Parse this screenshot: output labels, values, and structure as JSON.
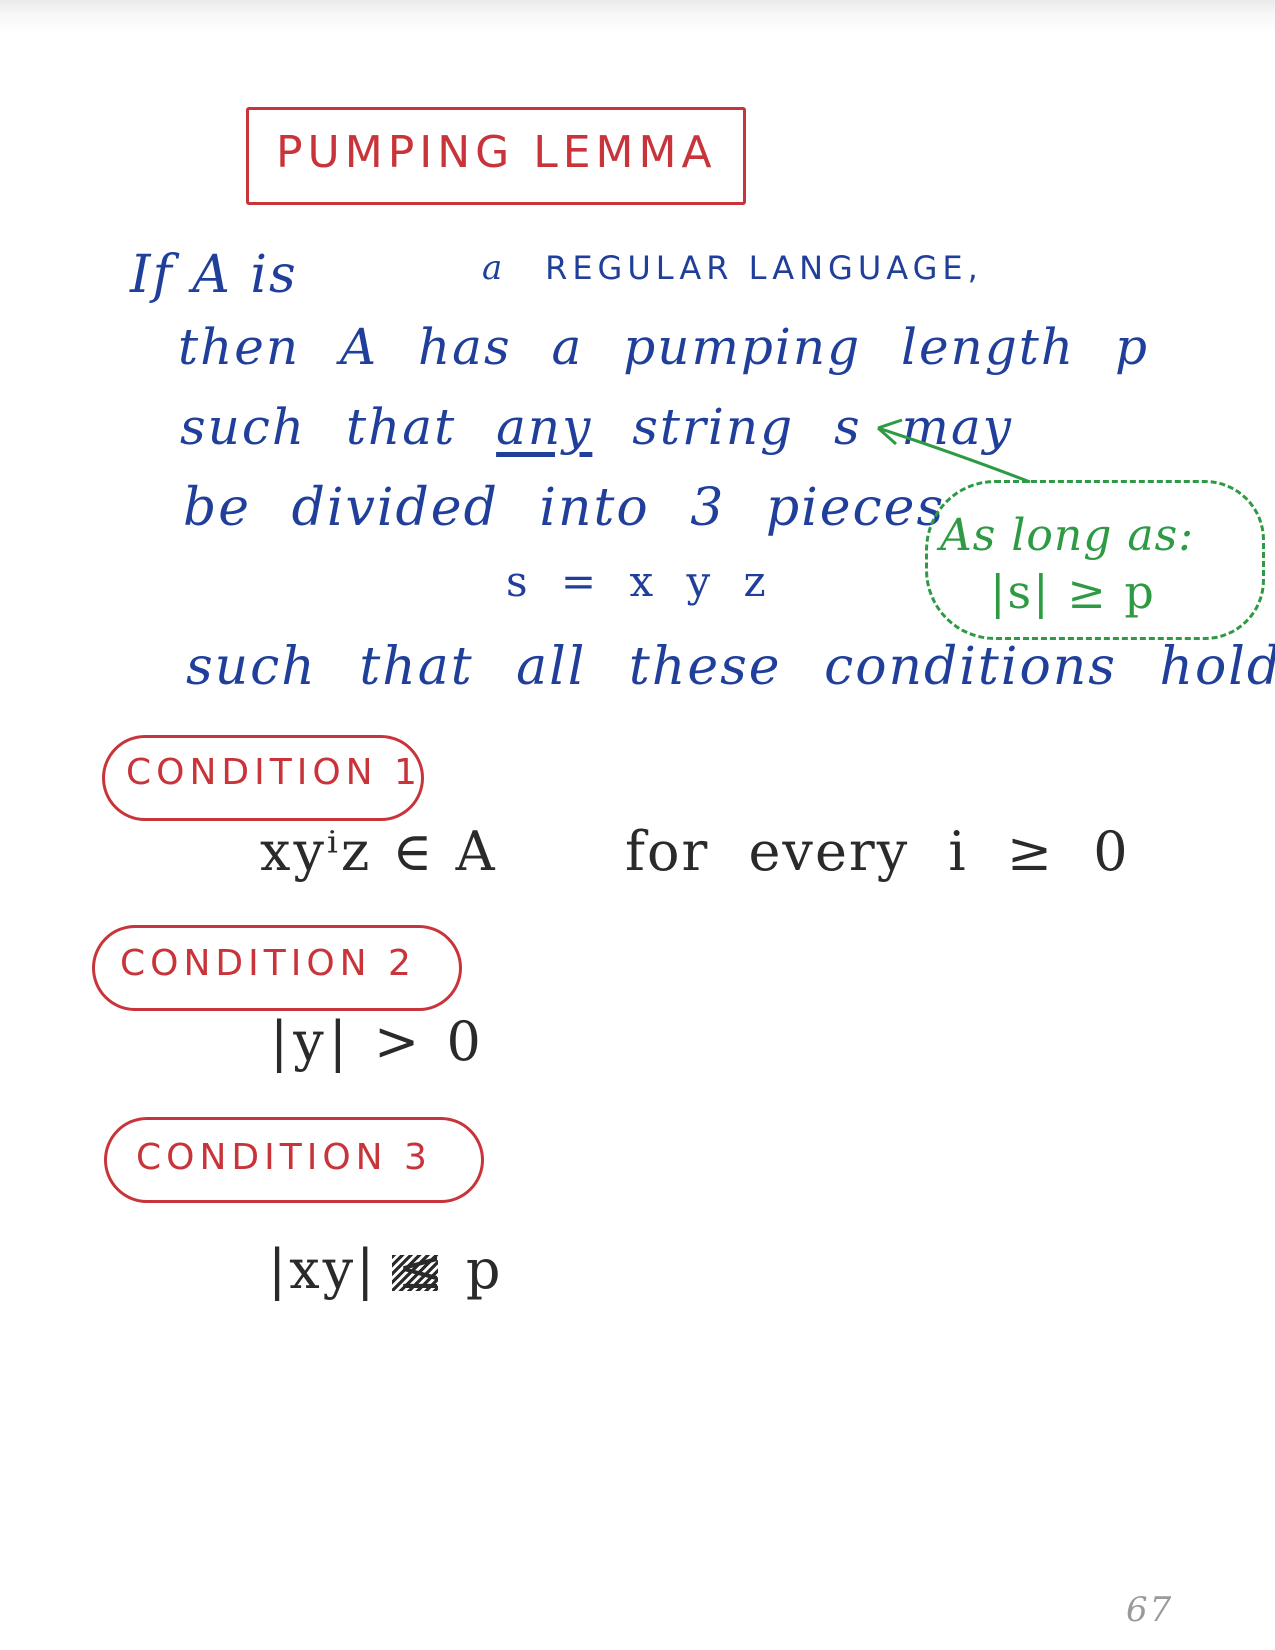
{
  "title": "PUMPING LEMMA",
  "statement": {
    "line1_prefix": "If A is",
    "line1_a": "a",
    "line1_caps": "REGULAR LANGUAGE,",
    "line2": "then A has a pumping length p",
    "line3_prefix": "such that",
    "line3_emph": "any",
    "line3_suffix": "string s may",
    "line4": "be divided into 3 pieces",
    "line5": "s = x y z",
    "line6": "such that all these conditions hold."
  },
  "note": {
    "line1": "As long as:",
    "line2": "|s| ≥ p"
  },
  "conditions": [
    {
      "label": "CONDITION 1",
      "formula": "xyⁱz ∈ A",
      "extra": "for every i ≥ 0"
    },
    {
      "label": "CONDITION 2",
      "formula": "|y| > 0"
    },
    {
      "label": "CONDITION 3",
      "formula": "|xy| ≤ p"
    }
  ],
  "page_number": "67",
  "colors": {
    "red": "#c8343a",
    "blue": "#1f3f9a",
    "green": "#2e9a44",
    "black": "#2a2a2a"
  }
}
